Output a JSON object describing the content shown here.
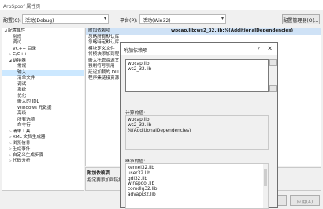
{
  "window": {
    "title": "ArpSpoof 属性页"
  },
  "toolbar": {
    "config_label": "配置(C):",
    "config_value": "活动(Debug)",
    "platform_label": "平台(P):",
    "platform_value": "活动(Win32)",
    "manager_button": "配置管理器(O)..."
  },
  "tree": {
    "items": [
      {
        "label": "配置属性",
        "level": 0,
        "twisty": "◢",
        "selected": false
      },
      {
        "label": "常规",
        "level": 1,
        "twisty": "",
        "selected": false
      },
      {
        "label": "调试",
        "level": 1,
        "twisty": "",
        "selected": false
      },
      {
        "label": "VC++ 目录",
        "level": 1,
        "twisty": "",
        "selected": false
      },
      {
        "label": "C/C++",
        "level": 1,
        "twisty": "▷",
        "selected": false
      },
      {
        "label": "链接器",
        "level": 1,
        "twisty": "◢",
        "selected": false
      },
      {
        "label": "常规",
        "level": 2,
        "twisty": "",
        "selected": false
      },
      {
        "label": "输入",
        "level": 2,
        "twisty": "",
        "selected": true
      },
      {
        "label": "清单文件",
        "level": 2,
        "twisty": "",
        "selected": false
      },
      {
        "label": "调试",
        "level": 2,
        "twisty": "",
        "selected": false
      },
      {
        "label": "系统",
        "level": 2,
        "twisty": "",
        "selected": false
      },
      {
        "label": "优化",
        "level": 2,
        "twisty": "",
        "selected": false
      },
      {
        "label": "嵌入的 IDL",
        "level": 2,
        "twisty": "",
        "selected": false
      },
      {
        "label": "Windows 元数据",
        "level": 2,
        "twisty": "",
        "selected": false
      },
      {
        "label": "高级",
        "level": 2,
        "twisty": "",
        "selected": false
      },
      {
        "label": "所有选项",
        "level": 2,
        "twisty": "",
        "selected": false
      },
      {
        "label": "命令行",
        "level": 2,
        "twisty": "",
        "selected": false
      },
      {
        "label": "清单工具",
        "level": 1,
        "twisty": "▷",
        "selected": false
      },
      {
        "label": "XML 文档生成器",
        "level": 1,
        "twisty": "▷",
        "selected": false
      },
      {
        "label": "浏览信息",
        "level": 1,
        "twisty": "▷",
        "selected": false
      },
      {
        "label": "生成事件",
        "level": 1,
        "twisty": "▷",
        "selected": false
      },
      {
        "label": "自定义生成步骤",
        "level": 1,
        "twisty": "▷",
        "selected": false
      },
      {
        "label": "代码分析",
        "level": 1,
        "twisty": "▷",
        "selected": false
      }
    ]
  },
  "grid": {
    "rows": [
      {
        "name": "附加依赖项",
        "value": "wpcap.lib;ws2_32.lib;%(AdditionalDependencies)",
        "selected": true
      },
      {
        "name": "忽略所有默认库",
        "value": "",
        "selected": false
      },
      {
        "name": "忽略特定默认库",
        "value": "",
        "selected": false
      },
      {
        "name": "模块定义文件",
        "value": "",
        "selected": false
      },
      {
        "name": "将模块添加到程",
        "value": "",
        "selected": false
      },
      {
        "name": "嵌入托管资源文",
        "value": "",
        "selected": false
      },
      {
        "name": "强制符号引用",
        "value": "",
        "selected": false
      },
      {
        "name": "延迟加载的 DLL",
        "value": "",
        "selected": false
      },
      {
        "name": "程序集链接资源",
        "value": "",
        "selected": false
      }
    ]
  },
  "description": {
    "title": "附加依赖项",
    "text": "指定要添加到链接命令行"
  },
  "buttons": {
    "cancel": "取消",
    "apply": "应用(A)"
  },
  "dialog": {
    "title": "附加依赖项",
    "help": "?",
    "close": "✕",
    "edit_lines": [
      "wpcap.lib",
      "ws2_32.lib"
    ],
    "computed_label": "计算的值:",
    "computed_lines": [
      "wpcap.lib",
      "ws2_32.lib",
      "%(AdditionalDependencies)"
    ],
    "inherited_label": "继承的值:",
    "inherited_lines": [
      "kernel32.lib",
      "user32.lib",
      "gdi32.lib",
      "winspool.lib",
      "comdlg32.lib",
      "advapi32.lib"
    ]
  }
}
